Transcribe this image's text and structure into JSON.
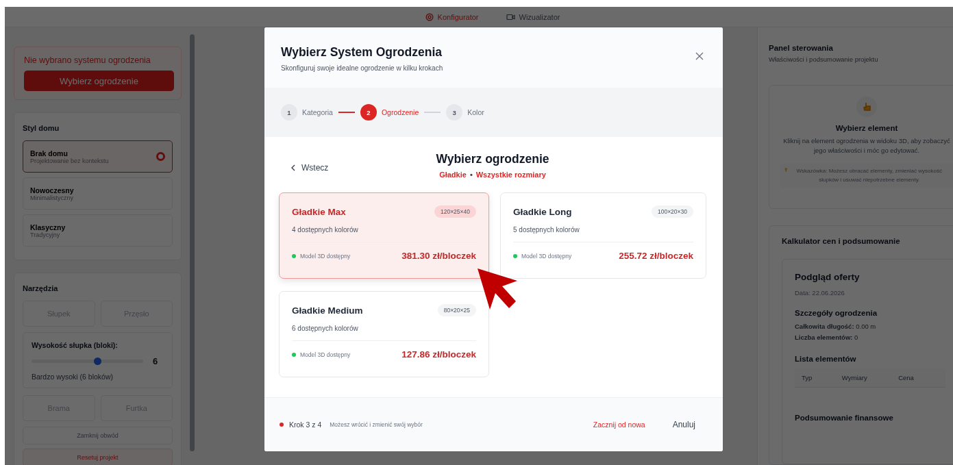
{
  "top_nav": {
    "tabs": [
      {
        "label": "Konfigurator",
        "selected": true
      },
      {
        "label": "Wizualizator",
        "selected": false
      }
    ]
  },
  "left_panel": {
    "alert": {
      "message": "Nie wybrano systemu ogrodzenia",
      "button": "Wybierz ogrodzenie"
    },
    "house_style": {
      "title": "Styl domu",
      "options": [
        {
          "name": "Brak domu",
          "description": "Projektowanie bez kontekstu",
          "selected": true
        },
        {
          "name": "Nowoczesny",
          "description": "Minimalistyczny",
          "selected": false
        },
        {
          "name": "Klasyczny",
          "description": "Tradycyjny",
          "selected": false
        }
      ]
    },
    "tools": {
      "title": "Narzędzia",
      "row_1": [
        {
          "label": "Słupek",
          "disabled": true
        },
        {
          "label": "Przęsło",
          "disabled": true
        }
      ],
      "post_height": {
        "label": "Wysokość słupka (bloki):",
        "level": 0.59,
        "value": "6",
        "description": "Bardzo wysoki (6 bloków)"
      },
      "row_2": [
        {
          "label": "Brama",
          "disabled": true
        },
        {
          "label": "Furtka",
          "disabled": true
        }
      ],
      "close_loop": {
        "label": "Zamknij obwód",
        "disabled": true
      },
      "reset": {
        "label": "Resetuj projekt"
      }
    }
  },
  "right_panel": {
    "title": "Panel sterowania",
    "subtitle": "Właściwości i podsumowanie projektu",
    "select_card": {
      "title": "Wybierz element",
      "text": "Kliknij na element ogrodzenia w widoku 3D, aby zobaczyć jego właściwości i móc go edytować.",
      "tip": "Wskazówka: Możesz obracać elementy, zmieniać wysokość słupków i usuwać niepotrzebne elementy."
    },
    "calculator": {
      "title": "Kalkulator cen i podsumowanie",
      "preview_title": "Podgląd oferty",
      "date": "Data: 22.06.2026",
      "details_title": "Szczegóły ogrodzenia",
      "details": [
        "**Całkowita długość:** 0.00 m",
        "**Liczba elementów:** 0"
      ],
      "list_title": "Lista elementów",
      "columns": [
        "Typ",
        "Wymiary",
        "Cena"
      ],
      "finance_title": "Podsumowanie finansowe"
    }
  },
  "modal": {
    "title": "Wybierz System Ogrodzenia",
    "subtitle": "Skonfiguruj swoje idealne ogrodzenie w kilku krokach",
    "steps": [
      {
        "number": "1",
        "label": "Kategoria",
        "selected": false
      },
      {
        "number": "2",
        "label": "Ogrodzenie",
        "selected": true
      },
      {
        "number": "3",
        "label": "Kolor",
        "selected": false
      }
    ],
    "back": "Wstecz",
    "heading": "Wybierz ogrodzenie",
    "filter": {
      "category": "Gładkie",
      "separator": "•",
      "size": "Wszystkie rozmiary"
    },
    "products": [
      {
        "name": "Gładkie Max",
        "dimensions": "120×25×40",
        "colors": "4 dostępnych kolorów",
        "model_available": true,
        "model_label": "Model 3D dostępny",
        "price": "381.30 zł/bloczek",
        "selected": true
      },
      {
        "name": "Gładkie Long",
        "dimensions": "100×20×30",
        "colors": "5 dostępnych kolorów",
        "model_available": true,
        "model_label": "Model 3D dostępny",
        "price": "255.72 zł/bloczek",
        "selected": false
      },
      {
        "name": "Gładkie Medium",
        "dimensions": "80×20×25",
        "colors": "6 dostępnych kolorów",
        "model_available": true,
        "model_label": "Model 3D dostępny",
        "price": "127.86 zł/bloczek",
        "selected": false
      }
    ],
    "footer": {
      "step": "Krok 3 z 4",
      "hint": "Możesz wrócić i zmienić swój wybór",
      "restart": "Zacznij od nowa",
      "cancel": "Anuluj"
    }
  }
}
